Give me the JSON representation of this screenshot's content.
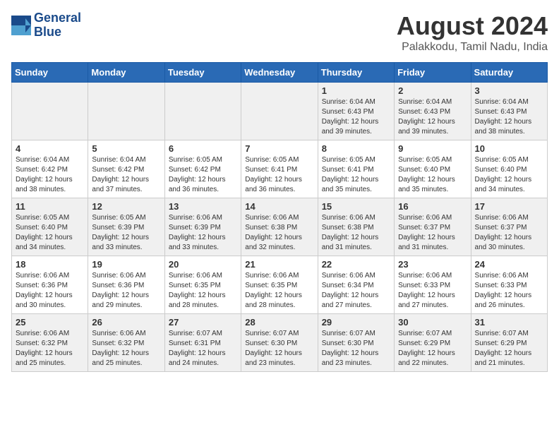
{
  "header": {
    "logo_line1": "General",
    "logo_line2": "Blue",
    "month_title": "August 2024",
    "location": "Palakkodu, Tamil Nadu, India"
  },
  "weekdays": [
    "Sunday",
    "Monday",
    "Tuesday",
    "Wednesday",
    "Thursday",
    "Friday",
    "Saturday"
  ],
  "weeks": [
    [
      {
        "day": "",
        "info": ""
      },
      {
        "day": "",
        "info": ""
      },
      {
        "day": "",
        "info": ""
      },
      {
        "day": "",
        "info": ""
      },
      {
        "day": "1",
        "info": "Sunrise: 6:04 AM\nSunset: 6:43 PM\nDaylight: 12 hours\nand 39 minutes."
      },
      {
        "day": "2",
        "info": "Sunrise: 6:04 AM\nSunset: 6:43 PM\nDaylight: 12 hours\nand 39 minutes."
      },
      {
        "day": "3",
        "info": "Sunrise: 6:04 AM\nSunset: 6:43 PM\nDaylight: 12 hours\nand 38 minutes."
      }
    ],
    [
      {
        "day": "4",
        "info": "Sunrise: 6:04 AM\nSunset: 6:42 PM\nDaylight: 12 hours\nand 38 minutes."
      },
      {
        "day": "5",
        "info": "Sunrise: 6:04 AM\nSunset: 6:42 PM\nDaylight: 12 hours\nand 37 minutes."
      },
      {
        "day": "6",
        "info": "Sunrise: 6:05 AM\nSunset: 6:42 PM\nDaylight: 12 hours\nand 36 minutes."
      },
      {
        "day": "7",
        "info": "Sunrise: 6:05 AM\nSunset: 6:41 PM\nDaylight: 12 hours\nand 36 minutes."
      },
      {
        "day": "8",
        "info": "Sunrise: 6:05 AM\nSunset: 6:41 PM\nDaylight: 12 hours\nand 35 minutes."
      },
      {
        "day": "9",
        "info": "Sunrise: 6:05 AM\nSunset: 6:40 PM\nDaylight: 12 hours\nand 35 minutes."
      },
      {
        "day": "10",
        "info": "Sunrise: 6:05 AM\nSunset: 6:40 PM\nDaylight: 12 hours\nand 34 minutes."
      }
    ],
    [
      {
        "day": "11",
        "info": "Sunrise: 6:05 AM\nSunset: 6:40 PM\nDaylight: 12 hours\nand 34 minutes."
      },
      {
        "day": "12",
        "info": "Sunrise: 6:05 AM\nSunset: 6:39 PM\nDaylight: 12 hours\nand 33 minutes."
      },
      {
        "day": "13",
        "info": "Sunrise: 6:06 AM\nSunset: 6:39 PM\nDaylight: 12 hours\nand 33 minutes."
      },
      {
        "day": "14",
        "info": "Sunrise: 6:06 AM\nSunset: 6:38 PM\nDaylight: 12 hours\nand 32 minutes."
      },
      {
        "day": "15",
        "info": "Sunrise: 6:06 AM\nSunset: 6:38 PM\nDaylight: 12 hours\nand 31 minutes."
      },
      {
        "day": "16",
        "info": "Sunrise: 6:06 AM\nSunset: 6:37 PM\nDaylight: 12 hours\nand 31 minutes."
      },
      {
        "day": "17",
        "info": "Sunrise: 6:06 AM\nSunset: 6:37 PM\nDaylight: 12 hours\nand 30 minutes."
      }
    ],
    [
      {
        "day": "18",
        "info": "Sunrise: 6:06 AM\nSunset: 6:36 PM\nDaylight: 12 hours\nand 30 minutes."
      },
      {
        "day": "19",
        "info": "Sunrise: 6:06 AM\nSunset: 6:36 PM\nDaylight: 12 hours\nand 29 minutes."
      },
      {
        "day": "20",
        "info": "Sunrise: 6:06 AM\nSunset: 6:35 PM\nDaylight: 12 hours\nand 28 minutes."
      },
      {
        "day": "21",
        "info": "Sunrise: 6:06 AM\nSunset: 6:35 PM\nDaylight: 12 hours\nand 28 minutes."
      },
      {
        "day": "22",
        "info": "Sunrise: 6:06 AM\nSunset: 6:34 PM\nDaylight: 12 hours\nand 27 minutes."
      },
      {
        "day": "23",
        "info": "Sunrise: 6:06 AM\nSunset: 6:33 PM\nDaylight: 12 hours\nand 27 minutes."
      },
      {
        "day": "24",
        "info": "Sunrise: 6:06 AM\nSunset: 6:33 PM\nDaylight: 12 hours\nand 26 minutes."
      }
    ],
    [
      {
        "day": "25",
        "info": "Sunrise: 6:06 AM\nSunset: 6:32 PM\nDaylight: 12 hours\nand 25 minutes."
      },
      {
        "day": "26",
        "info": "Sunrise: 6:06 AM\nSunset: 6:32 PM\nDaylight: 12 hours\nand 25 minutes."
      },
      {
        "day": "27",
        "info": "Sunrise: 6:07 AM\nSunset: 6:31 PM\nDaylight: 12 hours\nand 24 minutes."
      },
      {
        "day": "28",
        "info": "Sunrise: 6:07 AM\nSunset: 6:30 PM\nDaylight: 12 hours\nand 23 minutes."
      },
      {
        "day": "29",
        "info": "Sunrise: 6:07 AM\nSunset: 6:30 PM\nDaylight: 12 hours\nand 23 minutes."
      },
      {
        "day": "30",
        "info": "Sunrise: 6:07 AM\nSunset: 6:29 PM\nDaylight: 12 hours\nand 22 minutes."
      },
      {
        "day": "31",
        "info": "Sunrise: 6:07 AM\nSunset: 6:29 PM\nDaylight: 12 hours\nand 21 minutes."
      }
    ]
  ]
}
